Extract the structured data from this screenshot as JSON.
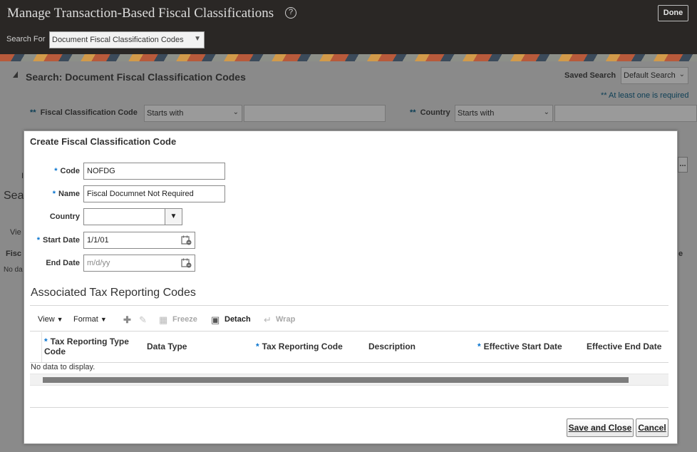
{
  "header": {
    "title": "Manage Transaction-Based Fiscal Classifications",
    "help_glyph": "?",
    "done_label": "Done",
    "search_for_label": "Search For",
    "search_for_value": "Document Fiscal Classification Codes"
  },
  "background": {
    "search_title": "Search: Document Fiscal Classification Codes",
    "saved_search_label": "Saved Search",
    "saved_search_value": "Default Search",
    "required_note": "** At least one is required",
    "fcc_req": "**",
    "fcc_label": "Fiscal Classification Code",
    "fcc_operator": "Starts with",
    "country_req": "**",
    "country_label": "Country",
    "country_operator": "Starts with",
    "stubs": {
      "sea": "Sea",
      "vie": "Vie",
      "fisc": "Fisc",
      "no_da": "No da",
      "ellipsis": "...",
      "e": "e",
      "i": "I"
    }
  },
  "modal": {
    "title": "Create Fiscal Classification Code",
    "fields": {
      "code": {
        "label": "Code",
        "required_mark": "*",
        "value": "NOFDG"
      },
      "name": {
        "label": "Name",
        "required_mark": "*",
        "value": "Fiscal Documnet Not Required"
      },
      "country": {
        "label": "Country",
        "value": ""
      },
      "start_date": {
        "label": "Start Date",
        "required_mark": "*",
        "value": "1/1/01"
      },
      "end_date": {
        "label": "End Date",
        "placeholder": "m/d/yy"
      }
    },
    "section_title": "Associated Tax Reporting Codes",
    "toolbar": {
      "view": "View",
      "format": "Format",
      "freeze": "Freeze",
      "detach": "Detach",
      "wrap": "Wrap"
    },
    "table": {
      "columns": [
        {
          "label": "Tax Reporting Type Code",
          "required": true
        },
        {
          "label": "Data Type",
          "required": false
        },
        {
          "label": "Tax Reporting Code",
          "required": true
        },
        {
          "label": "Description",
          "required": false
        },
        {
          "label": "Effective Start Date",
          "required": true
        },
        {
          "label": "Effective End Date",
          "required": false
        }
      ],
      "required_mark": "*",
      "empty_text": "No data to display."
    },
    "buttons": {
      "save_close": "Save and Close",
      "cancel": "Cancel"
    }
  },
  "icons": {
    "help": "help-circle-icon",
    "calendar": "calendar-icon",
    "dropdown": "chevron-down-icon",
    "add": "plus-icon",
    "edit": "pencil-icon",
    "freeze": "freeze-icon",
    "detach": "detach-icon",
    "wrap": "wrap-icon"
  },
  "colors": {
    "header_bg": "#2a2725",
    "required_blue": "#0572ce",
    "dim_bg": "#8a8a8a"
  }
}
